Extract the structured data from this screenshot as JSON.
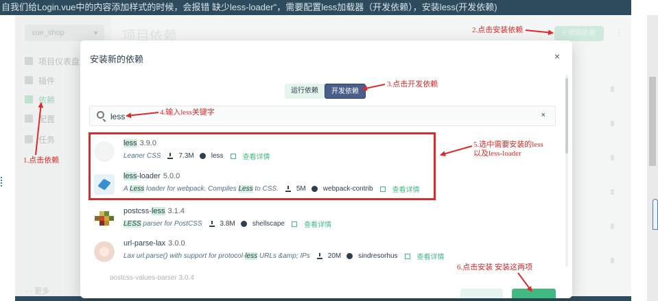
{
  "banner": {
    "text": "自我们给Login.vue中的内容添加样式的时候，会报错 缺少less-loader\"，需要配置less加载器（开发依赖），安装less(开发依赖)"
  },
  "background_app": {
    "project_name": "vue_shop",
    "nav": [
      {
        "label": "项目仪表盘"
      },
      {
        "label": "插件"
      },
      {
        "label": "依赖"
      },
      {
        "label": "配置"
      },
      {
        "label": "任务"
      }
    ],
    "more_label": "更多",
    "page_title": "项目依赖",
    "install_button": "+ 安装依赖"
  },
  "modal": {
    "title": "安装新的依赖",
    "close": "×",
    "tabs": [
      {
        "label": "运行依赖",
        "active": false
      },
      {
        "label": "开发依赖",
        "active": true
      }
    ],
    "search": {
      "value": "less",
      "clear": "×"
    },
    "details_label": "查看详情",
    "packages": [
      {
        "name_hl": "less",
        "name_rest": "",
        "version": "3.9.0",
        "desc_parts": [
          {
            "t": "Leaner CSS",
            "hl": false
          }
        ],
        "downloads": "7.3M",
        "author": "less",
        "logo": "blank-logo"
      },
      {
        "name_hl": "less",
        "name_rest": "-loader",
        "version": "5.0.0",
        "desc_parts": [
          {
            "t": "A ",
            "hl": false
          },
          {
            "t": "Less",
            "hl": true
          },
          {
            "t": " loader for webpack. Compiles ",
            "hl": false
          },
          {
            "t": "Less",
            "hl": true
          },
          {
            "t": " to CSS.",
            "hl": false
          }
        ],
        "downloads": "5M",
        "author": "webpack-contrib",
        "logo": "cube-logo"
      },
      {
        "name_pre": "postcss-",
        "name_hl": "less",
        "name_rest": "",
        "version": "3.1.4",
        "desc_parts": [
          {
            "t": "LESS",
            "hl": true
          },
          {
            "t": " parser for PostCSS",
            "hl": false
          }
        ],
        "downloads": "3.8M",
        "author": "shellscape",
        "logo": "postcss-logo"
      },
      {
        "name_pre": "url-parse-lax",
        "name_hl": "",
        "name_rest": "",
        "version": "3.0.0",
        "desc_parts": [
          {
            "t": "Lax url.parse() with support for protocol-",
            "hl": false
          },
          {
            "t": "less",
            "hl": true
          },
          {
            "t": " URLs &amp; IPs",
            "hl": false
          }
        ],
        "downloads": "20M",
        "author": "sindresorhus",
        "logo": "avatar-logo"
      }
    ],
    "cut_package": "postcss-values-parser 3.0.4"
  },
  "annotations": {
    "a1": "1.点击依赖",
    "a2": "2.点击安装依赖",
    "a3": "3.点击开发依赖",
    "a4": "4.输入less关键字",
    "a5_line1": "5.选中需要安装的less",
    "a5_line2": "以及less-loader",
    "a6": "6.点击安装 安装这两项",
    "color": "#e02828"
  }
}
